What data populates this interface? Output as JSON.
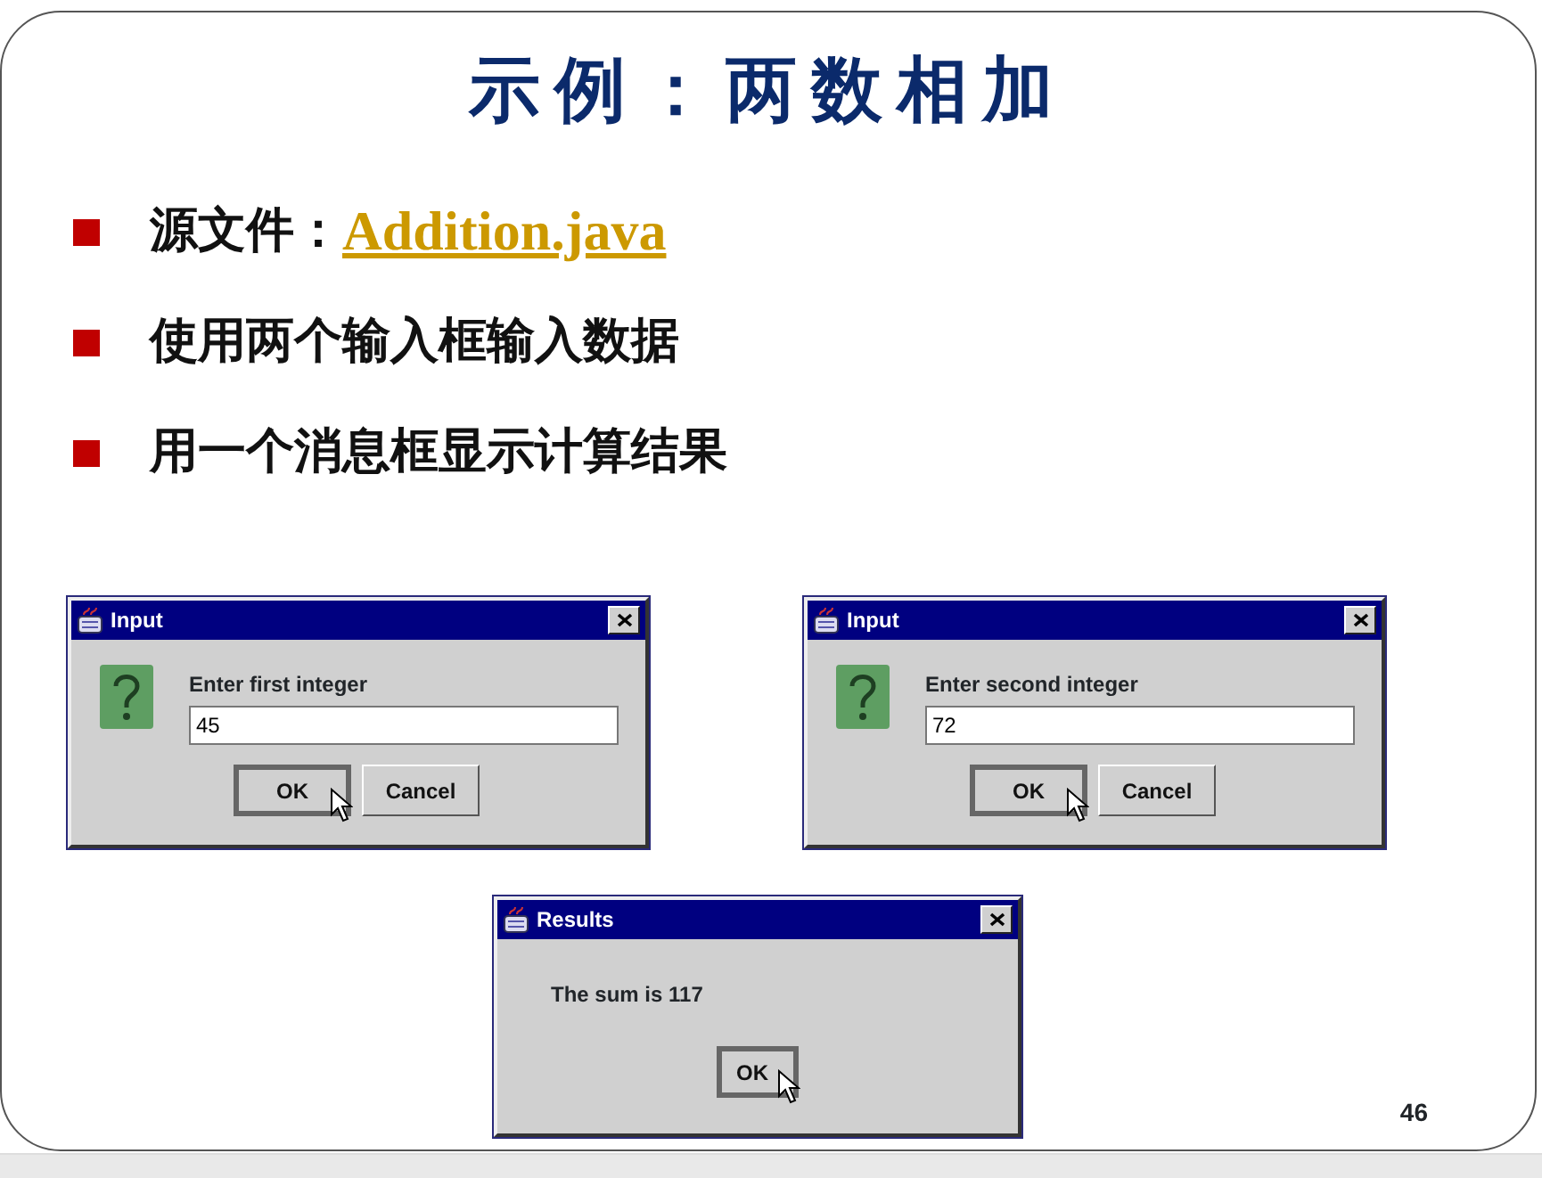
{
  "slide": {
    "title": "示例：两数相加",
    "page_number": "46"
  },
  "bullets": [
    {
      "text": "源文件：",
      "link": "Addition.java"
    },
    {
      "text": "使用两个输入框输入数据"
    },
    {
      "text": "用一个消息框显示计算结果"
    }
  ],
  "dialogs": [
    {
      "kind": "input",
      "title": "Input",
      "prompt": "Enter first integer",
      "value": "45",
      "buttons": [
        {
          "label": "OK",
          "focused": true,
          "hovered": true
        },
        {
          "label": "Cancel",
          "focused": false,
          "hovered": false
        }
      ]
    },
    {
      "kind": "input",
      "title": "Input",
      "prompt": "Enter second integer",
      "value": "72",
      "buttons": [
        {
          "label": "OK",
          "focused": true,
          "hovered": true
        },
        {
          "label": "Cancel",
          "focused": false,
          "hovered": false
        }
      ]
    },
    {
      "kind": "message",
      "title": "Results",
      "message": "The sum is 117",
      "buttons": [
        {
          "label": "OK",
          "focused": true,
          "hovered": true
        }
      ]
    }
  ]
}
